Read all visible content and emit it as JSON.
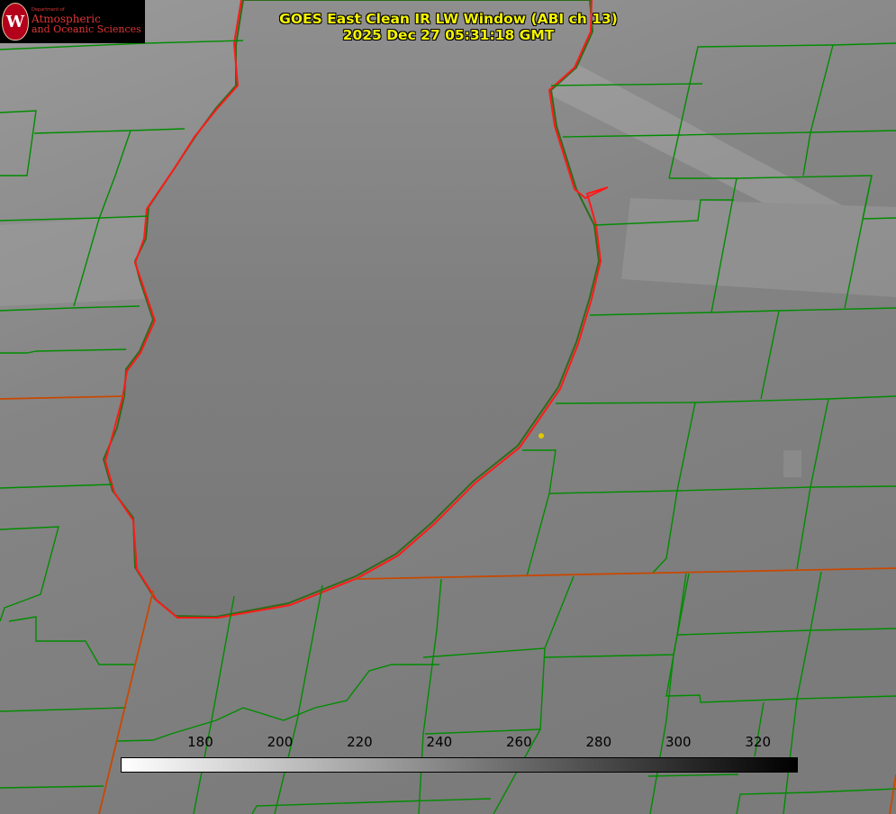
{
  "header": {
    "title_line1": "GOES East Clean IR LW Window (ABI ch 13)",
    "title_line2": "2025 Dec 27 05:31:18 GMT"
  },
  "logo": {
    "seal_letter": "W",
    "department": "Department of",
    "line1": "Atmospheric",
    "line2": "and Oceanic Sciences"
  },
  "colorbar": {
    "min": 160,
    "max": 330,
    "ticks": [
      "180",
      "200",
      "220",
      "240",
      "260",
      "280",
      "300",
      "320"
    ],
    "color_low": "#ffffff",
    "color_high": "#000000"
  },
  "map_colors": {
    "county_lines": "#008c00",
    "lake_shore": "#ff1a1a",
    "state_border": "#c84800",
    "marker": "#e0c800"
  }
}
